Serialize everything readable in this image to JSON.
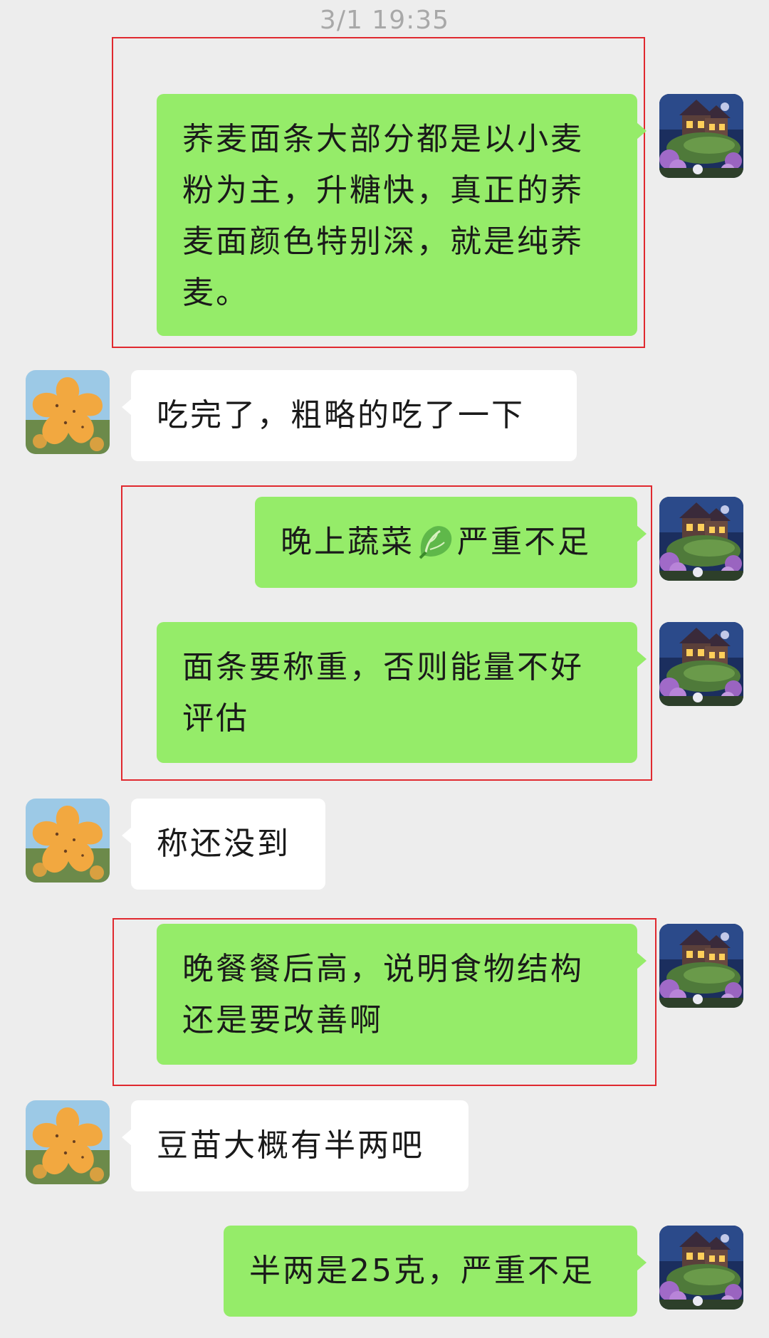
{
  "chat": {
    "timestamp": "3/1 19:35",
    "messages": [
      {
        "side": "right",
        "text": "荞麦面条大部分都是以小麦粉为主，升糖快，真正的荞麦面颜色特别深，就是纯荞麦。"
      },
      {
        "side": "left",
        "text": "吃完了，粗略的吃了一下"
      },
      {
        "side": "right",
        "text_before": "晚上蔬菜",
        "emoji": "lettuce-emoji",
        "text_after": "严重不足"
      },
      {
        "side": "right",
        "text": "面条要称重，否则能量不好评估"
      },
      {
        "side": "left",
        "text": "称还没到"
      },
      {
        "side": "right",
        "text": "晚餐餐后高，说明食物结构还是要改善啊"
      },
      {
        "side": "left",
        "text": "豆苗大概有半两吧"
      },
      {
        "side": "right",
        "text": "半两是25克，严重不足"
      }
    ]
  },
  "colors": {
    "background": "#ededed",
    "outgoing_bubble": "#95ec69",
    "incoming_bubble": "#ffffff",
    "highlight_border": "#e0292f",
    "timestamp_text": "#a8a8a8"
  },
  "icons": {
    "self_avatar": "night-house-avatar",
    "contact_avatar": "obscured-avatar"
  }
}
